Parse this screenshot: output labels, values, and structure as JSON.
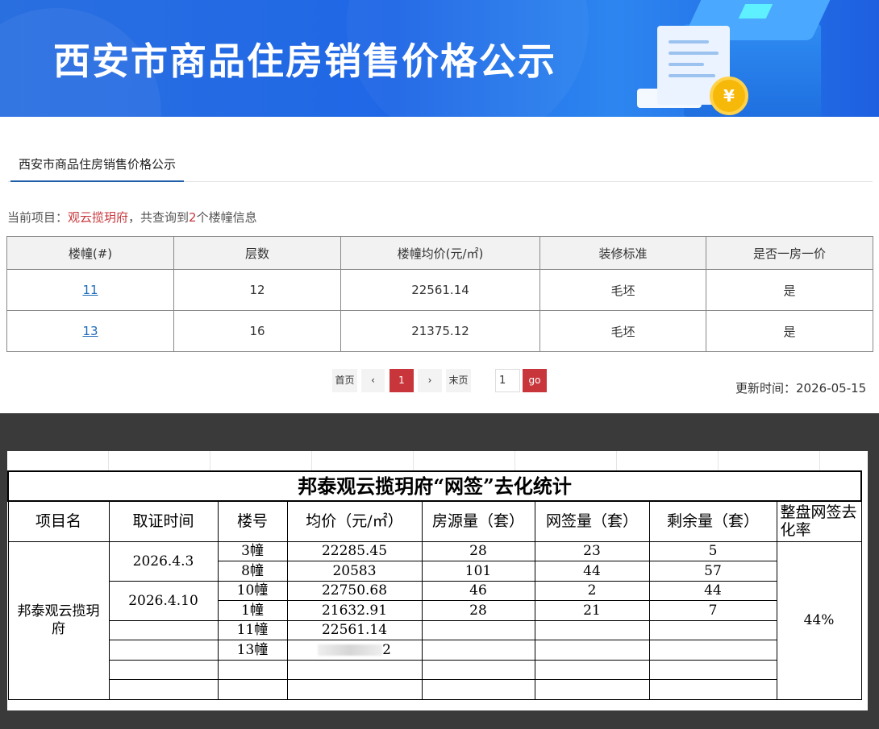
{
  "banner": {
    "title": "西安市商品住房销售价格公示",
    "coin_symbol": "¥"
  },
  "tab": {
    "label": "西安市商品住房销售价格公示"
  },
  "info": {
    "prefix": "当前项目：",
    "project": "观云揽玥府",
    "middle": "，共查询到",
    "count": "2",
    "suffix": "个楼幢信息"
  },
  "table": {
    "headers": [
      "楼幢(#)",
      "层数",
      "楼幢均价(元/㎡)",
      "装修标准",
      "是否一房一价"
    ],
    "rows": [
      {
        "building": "11",
        "floors": "12",
        "avg_price": "22561.14",
        "decoration": "毛坯",
        "one_price": "是"
      },
      {
        "building": "13",
        "floors": "16",
        "avg_price": "21375.12",
        "decoration": "毛坯",
        "one_price": "是"
      }
    ]
  },
  "pager": {
    "first": "首页",
    "prev": "‹",
    "current": "1",
    "next": "›",
    "last": "末页",
    "input_value": "1",
    "go": "go"
  },
  "updated": {
    "label": "更新时间：",
    "date": "2026-05-15"
  },
  "sheet": {
    "title": "邦泰观云揽玥府“网签”去化统计",
    "headers": [
      "项目名",
      "取证时间",
      "楼号",
      "均价（元/㎡）",
      "房源量（套）",
      "网签量（套）",
      "剩余量（套）",
      "整盘网签去化率"
    ],
    "project_name": "邦泰观云揽玥府",
    "dates": [
      "2026.4.3",
      "2026.4.10"
    ],
    "rows": [
      {
        "building": "3幢",
        "price": "22285.45",
        "supply": "28",
        "signed": "23",
        "remaining": "5"
      },
      {
        "building": "8幢",
        "price": "20583",
        "supply": "101",
        "signed": "44",
        "remaining": "57"
      },
      {
        "building": "10幢",
        "price": "22750.68",
        "supply": "46",
        "signed": "2",
        "remaining": "44"
      },
      {
        "building": "1幢",
        "price": "21632.91",
        "supply": "28",
        "signed": "21",
        "remaining": "7"
      },
      {
        "building": "11幢",
        "price": "22561.14",
        "supply": "",
        "signed": "",
        "remaining": ""
      },
      {
        "building": "13幢",
        "price": "2",
        "supply": "",
        "signed": "",
        "remaining": ""
      }
    ],
    "rate": "44%"
  }
}
